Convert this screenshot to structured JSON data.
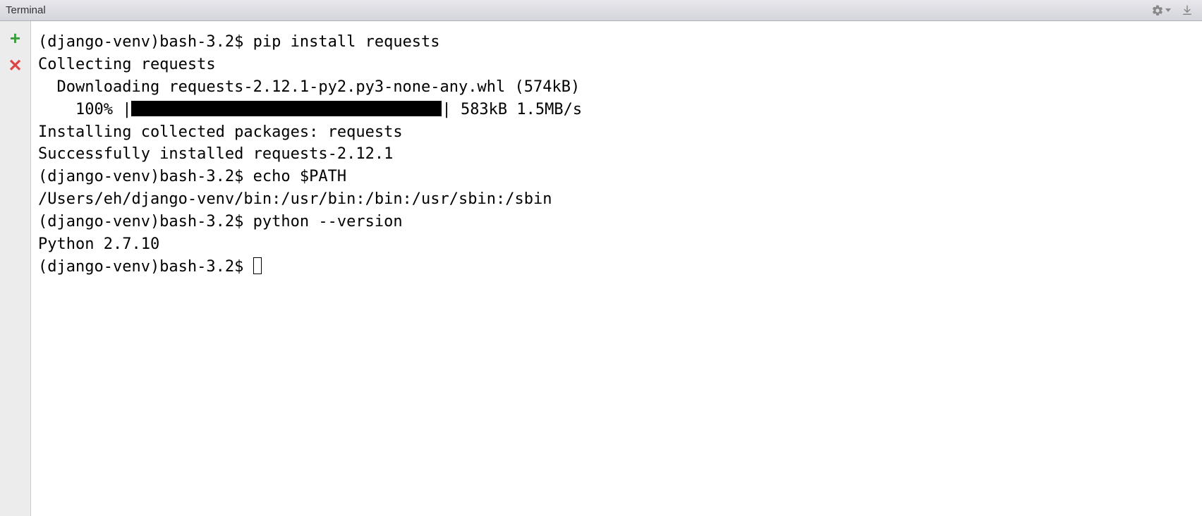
{
  "header": {
    "title": "Terminal"
  },
  "terminal": {
    "lines": [
      {
        "prompt": "(django-venv)bash-3.2$ ",
        "cmd": "pip install requests"
      },
      {
        "text": "Collecting requests"
      },
      {
        "text": "  Downloading requests-2.12.1-py2.py3-none-any.whl (574kB)"
      },
      {
        "progress_prefix": "    100% |",
        "progress_suffix": "| 583kB 1.5MB/s"
      },
      {
        "text": "Installing collected packages: requests"
      },
      {
        "text": "Successfully installed requests-2.12.1"
      },
      {
        "prompt": "(django-venv)bash-3.2$ ",
        "cmd": "echo $PATH"
      },
      {
        "text": "/Users/eh/django-venv/bin:/usr/bin:/bin:/usr/sbin:/sbin"
      },
      {
        "prompt": "(django-venv)bash-3.2$ ",
        "cmd": "python --version"
      },
      {
        "text": "Python 2.7.10"
      },
      {
        "prompt": "(django-venv)bash-3.2$ ",
        "cursor": true
      }
    ]
  }
}
